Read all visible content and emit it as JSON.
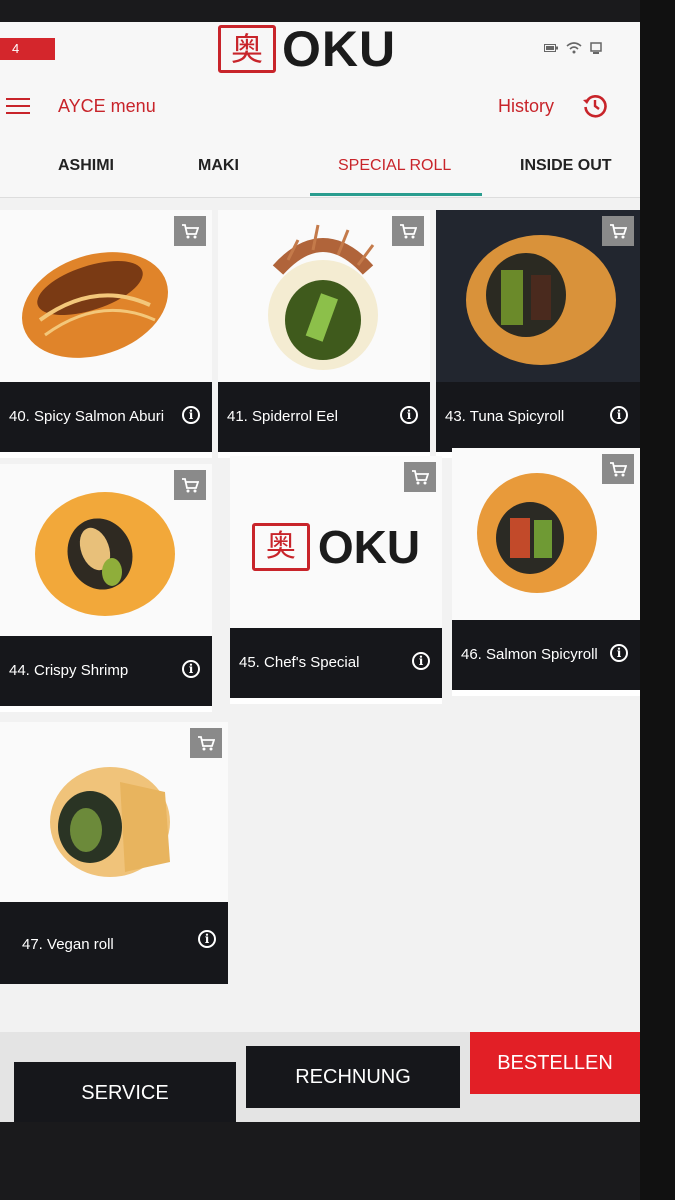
{
  "status": {
    "badge": "4"
  },
  "brand": {
    "logo_glyph": "奥",
    "name": "OKU"
  },
  "toolbar": {
    "menu_title": "AYCE menu",
    "history_label": "History"
  },
  "tabs": [
    {
      "label": "ASHIMI",
      "active": false
    },
    {
      "label": "MAKI",
      "active": false
    },
    {
      "label": "SPECIAL ROLL",
      "active": true
    },
    {
      "label": "INSIDE OUT",
      "active": false
    }
  ],
  "products": [
    {
      "name": "40. Spicy Salmon Aburi"
    },
    {
      "name": "41. Spiderrol Eel"
    },
    {
      "name": "43. Tuna Spicyroll"
    },
    {
      "name": "44. Crispy Shrimp"
    },
    {
      "name": "45. Chef's Special",
      "logo_glyph": "奥",
      "logo_text": "OKU"
    },
    {
      "name": "46. Salmon Spicyroll"
    },
    {
      "name": "47. Vegan roll"
    }
  ],
  "actions": {
    "service": "SERVICE",
    "bill": "RECHNUNG",
    "order": "BESTELLEN"
  },
  "colors": {
    "accent": "#c8242a",
    "order_button": "#e21f26",
    "dark": "#16171b",
    "tab_indicator": "#2a9d8f"
  }
}
